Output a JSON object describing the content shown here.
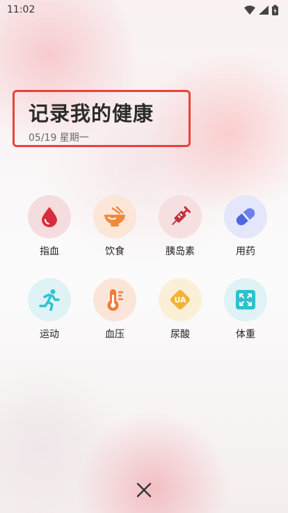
{
  "status_bar": {
    "time": "11:02"
  },
  "header": {
    "title": "记录我的健康",
    "date": "05/19 星期一"
  },
  "items": [
    {
      "label": "指血",
      "icon": "blood-drop-icon",
      "bg": "#f5dcdf",
      "color": "#d72c3d"
    },
    {
      "label": "饮食",
      "icon": "food-bowl-icon",
      "bg": "#fbe6d8",
      "color": "#f08a3a"
    },
    {
      "label": "胰岛素",
      "icon": "syringe-icon",
      "bg": "#f5dfe1",
      "color": "#c62f3c"
    },
    {
      "label": "用药",
      "icon": "pill-icon",
      "bg": "#e4e6f9",
      "color": "#4f66e0"
    },
    {
      "label": "运动",
      "icon": "running-icon",
      "bg": "#dff2f5",
      "color": "#2cc4d2"
    },
    {
      "label": "血压",
      "icon": "blood-pressure-icon",
      "bg": "#fbe5d8",
      "color": "#ef7b3b"
    },
    {
      "label": "尿酸",
      "icon": "uric-acid-icon",
      "bg": "#fcefd8",
      "color": "#f2b233",
      "badge": "UA"
    },
    {
      "label": "体重",
      "icon": "scale-icon",
      "bg": "#dff2f5",
      "color": "#2ec1cf"
    }
  ]
}
